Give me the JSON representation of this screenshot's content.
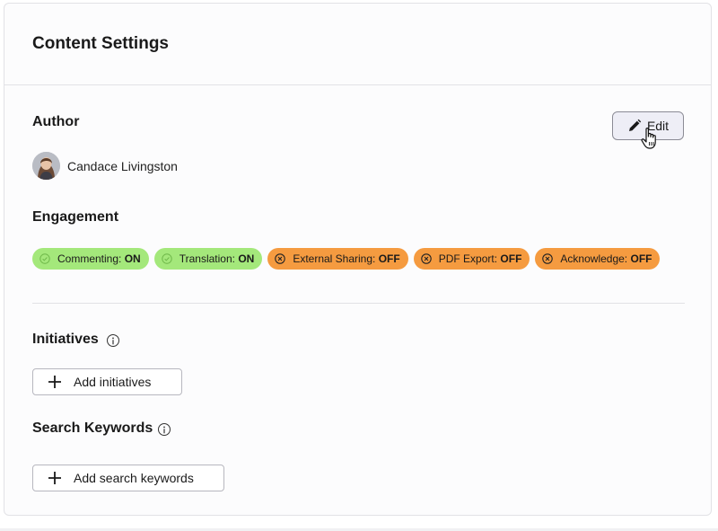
{
  "card": {
    "title": "Content Settings"
  },
  "author": {
    "heading": "Author",
    "name": "Candace Livingston",
    "edit_label": "Edit"
  },
  "engagement": {
    "heading": "Engagement",
    "pills": [
      {
        "label": "Commenting:",
        "state": "ON",
        "status": "on"
      },
      {
        "label": "Translation:",
        "state": "ON",
        "status": "on"
      },
      {
        "label": "External Sharing:",
        "state": "OFF",
        "status": "off"
      },
      {
        "label": "PDF Export:",
        "state": "OFF",
        "status": "off"
      },
      {
        "label": "Acknowledge:",
        "state": "OFF",
        "status": "off"
      }
    ]
  },
  "initiatives": {
    "heading": "Initiatives",
    "add_label": "Add initiatives"
  },
  "keywords": {
    "heading": "Search Keywords",
    "add_label": "Add search keywords"
  },
  "colors": {
    "on": "#a4e87b",
    "off": "#f59b40",
    "edit_bg": "#eeeef6"
  },
  "icons": {
    "edit": "pencil-icon",
    "on_pill": "check-circle-icon",
    "off_pill": "x-circle-icon",
    "info": "info-icon",
    "add": "plus-icon",
    "cursor": "hand-pointer-icon"
  }
}
